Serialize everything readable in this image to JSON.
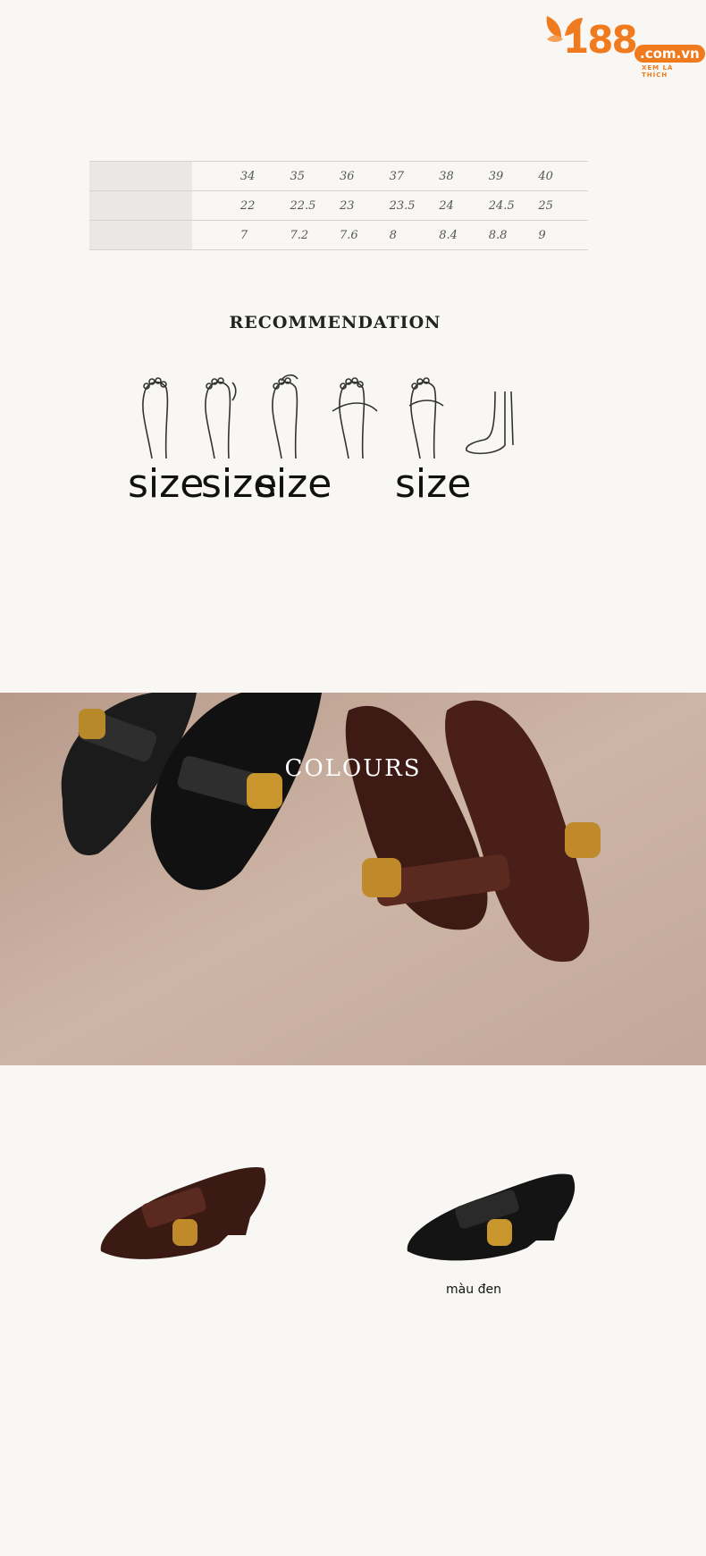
{
  "logo": {
    "number": "188",
    "domain": ".com.vn",
    "tagline": "XEM LÀ THÍCH"
  },
  "size_table": {
    "rows": [
      [
        "34",
        "35",
        "36",
        "37",
        "38",
        "39",
        "40"
      ],
      [
        "22",
        "22.5",
        "23",
        "23.5",
        "24",
        "24.5",
        "25"
      ],
      [
        "7",
        "7.2",
        "7.6",
        "8",
        "8.4",
        "8.8",
        "9"
      ]
    ]
  },
  "recommendation": {
    "title": "RECOMMENDATION",
    "labels": [
      "size",
      "size",
      "size",
      "size"
    ]
  },
  "colours": {
    "title": "COLOURS"
  },
  "variants": [
    {
      "label": ""
    },
    {
      "label": "màu đen"
    }
  ],
  "colors": {
    "brand": "#f07a1e",
    "background": "#f8f7f4"
  }
}
